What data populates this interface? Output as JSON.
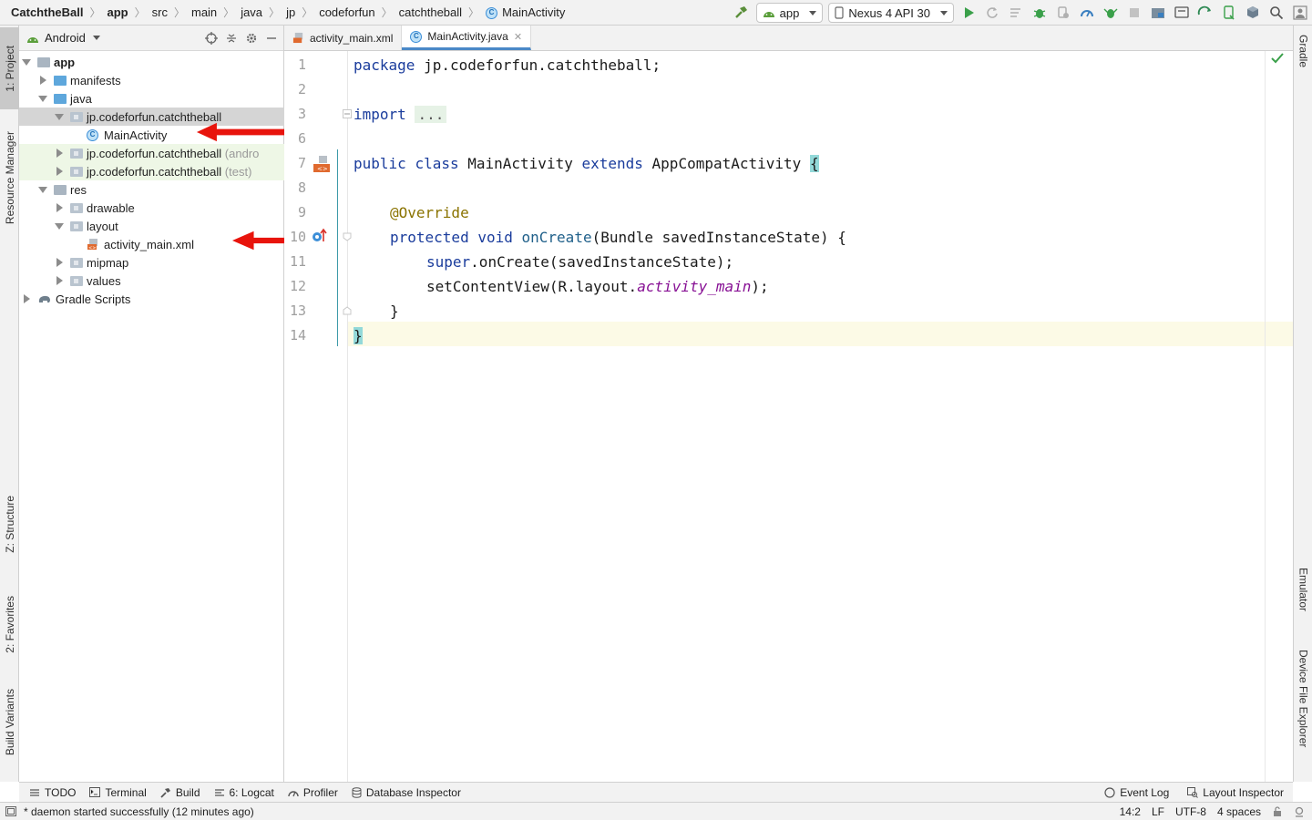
{
  "breadcrumbs": [
    "CatchtheBall",
    "app",
    "src",
    "main",
    "java",
    "jp",
    "codeforfun",
    "catchtheball",
    "MainActivity"
  ],
  "toolbar": {
    "run_config": "app",
    "device": "Nexus 4 API 30",
    "icons": [
      "hammer-icon",
      "play-icon",
      "rerun-icon",
      "apply-changes-icon",
      "debug-icon",
      "attach-icon",
      "profile-icon",
      "coverage-icon",
      "stop-icon",
      "project-structure-icon",
      "avd-manager-icon",
      "sdk-manager-icon",
      "sync-icon",
      "search-icon",
      "account-icon"
    ]
  },
  "left_tabs": {
    "project": "1: Project",
    "resource_manager": "Resource Manager",
    "structure": "Z: Structure",
    "favorites": "2: Favorites",
    "build_variants": "Build Variants"
  },
  "right_tabs": {
    "gradle": "Gradle",
    "emulator": "Emulator",
    "device_file_explorer": "Device File Explorer"
  },
  "project_panel": {
    "view_mode": "Android",
    "tree": [
      {
        "label": "app",
        "bold": true
      },
      {
        "label": "manifests"
      },
      {
        "label": "java"
      },
      {
        "label": "jp.codeforfun.catchtheball"
      },
      {
        "label": "MainActivity"
      },
      {
        "label": "jp.codeforfun.catchtheball",
        "suffix": "(andro"
      },
      {
        "label": "jp.codeforfun.catchtheball",
        "suffix": "(test)"
      },
      {
        "label": "res"
      },
      {
        "label": "drawable"
      },
      {
        "label": "layout"
      },
      {
        "label": "activity_main.xml"
      },
      {
        "label": "mipmap"
      },
      {
        "label": "values"
      },
      {
        "label": "Gradle Scripts"
      }
    ]
  },
  "editor": {
    "tabs": [
      {
        "label": "activity_main.xml",
        "active": false
      },
      {
        "label": "MainActivity.java",
        "active": true
      }
    ],
    "line_numbers": [
      "1",
      "2",
      "3",
      "6",
      "7",
      "8",
      "9",
      "10",
      "11",
      "12",
      "13",
      "14"
    ],
    "code": {
      "l1_kw": "package",
      "l1_rest": " jp.codeforfun.catchtheball;",
      "l3_kw": "import",
      "l3_fold": "...",
      "l7_kw1": "public",
      "l7_kw2": "class",
      "l7_name": " MainActivity ",
      "l7_kw3": "extends",
      "l7_super": " AppCompatActivity ",
      "l7_brace": "{",
      "l9_ann": "@Override",
      "l10_kw1": "protected",
      "l10_kw2": "void",
      "l10_fn": "onCreate",
      "l10_rest": "(Bundle savedInstanceState) {",
      "l11_kw": "super",
      "l11_rest": ".onCreate(savedInstanceState);",
      "l12_a": "setContentView(R.layout.",
      "l12_it": "activity_main",
      "l12_b": ");",
      "l13": "}",
      "l14": "}"
    }
  },
  "bottom_tools": [
    "TODO",
    "Terminal",
    "Build",
    "6: Logcat",
    "Profiler",
    "Database Inspector"
  ],
  "bottom_tools_right": [
    "Event Log",
    "Layout Inspector"
  ],
  "status": {
    "message": "* daemon started successfully (12 minutes ago)",
    "position": "14:2",
    "line_sep": "LF",
    "encoding": "UTF-8",
    "indent": "4 spaces"
  },
  "colors": {
    "annotation_arrow": "#e8140c",
    "keyword": "#1a3c9c",
    "selection": "#d5d5d5"
  }
}
